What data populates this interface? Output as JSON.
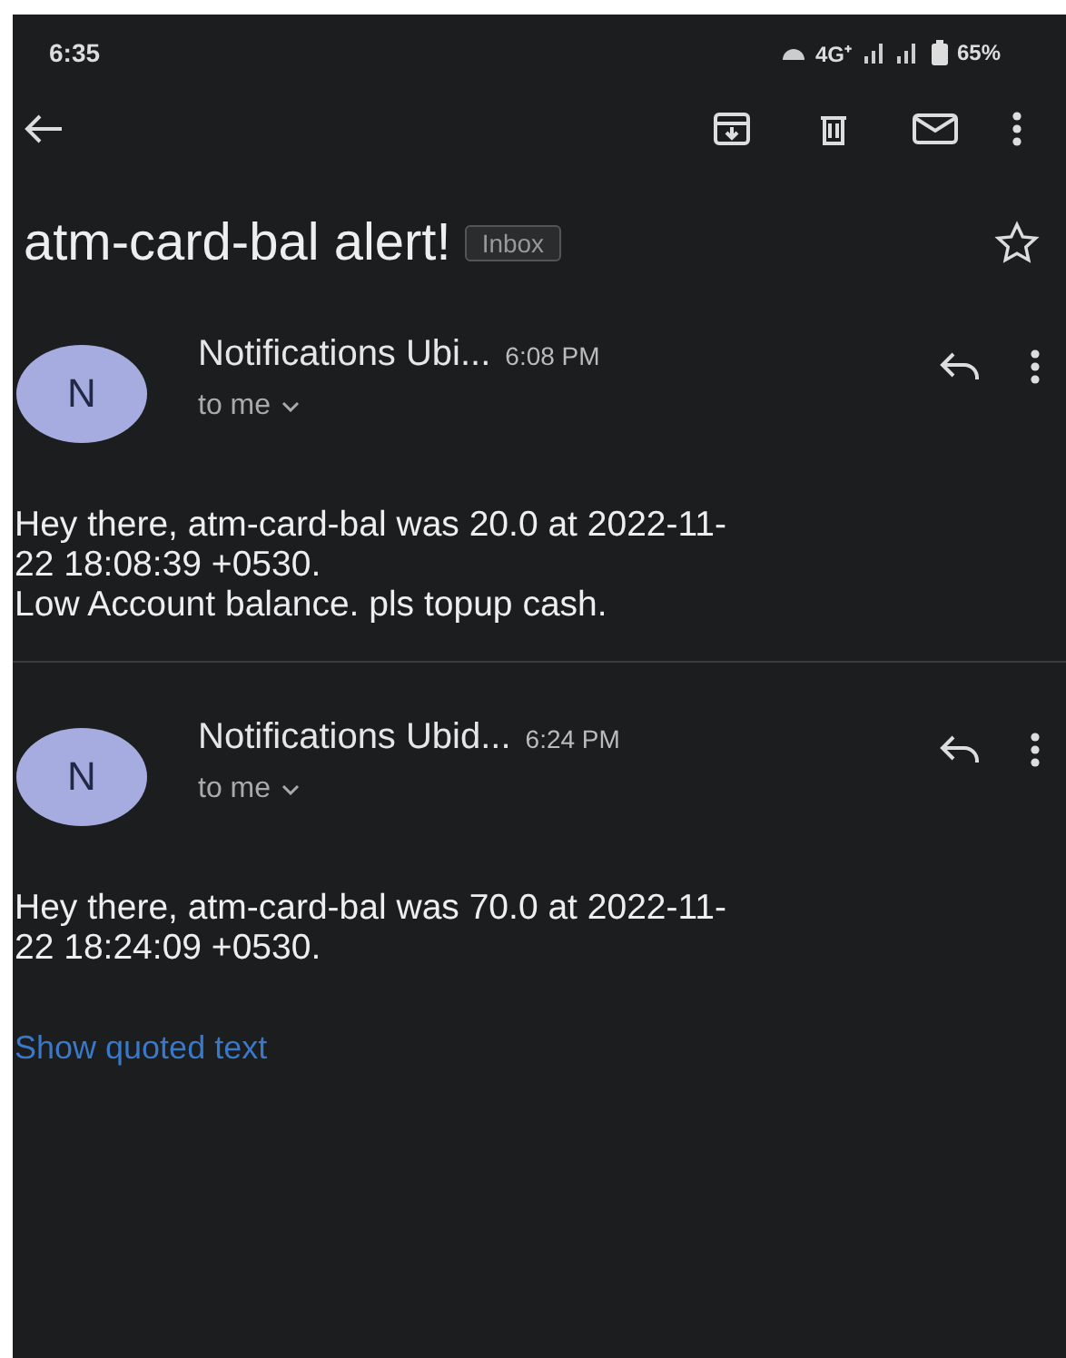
{
  "status_bar": {
    "time": "6:35",
    "network": "4G⁺",
    "battery": "65%"
  },
  "subject": {
    "title": "atm-card-bal alert!",
    "label": "Inbox",
    "starred": false
  },
  "messages": [
    {
      "avatar": "N",
      "sender": "Notifications Ubi...",
      "time": "6:08 PM",
      "recipient": "to me",
      "body": [
        "Hey there, atm-card-bal was 20.0 at 2022-11-",
        "22 18:08:39 +0530.",
        "Low Account balance. pls topup cash."
      ]
    },
    {
      "avatar": "N",
      "sender": "Notifications Ubid...",
      "time": "6:24 PM",
      "recipient": "to me",
      "body": [
        "Hey there, atm-card-bal was 70.0 at 2022-11-",
        "22 18:24:09 +0530."
      ],
      "link": "Show quoted text"
    }
  ]
}
